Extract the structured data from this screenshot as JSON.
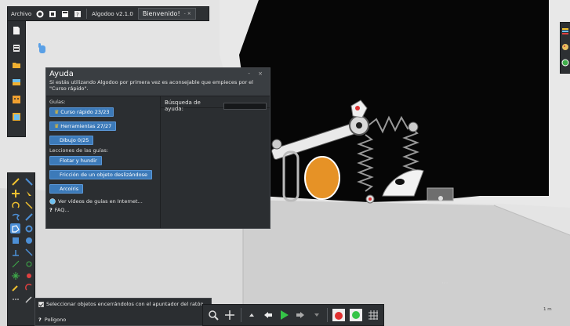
{
  "menubar": {
    "archivo_label": "Archivo",
    "app_version": "Algodoo v2.1.0",
    "tab_label": "Bienvenido!",
    "tab_controls": "- ×"
  },
  "help": {
    "title": "Ayuda",
    "window_controls": "- ×",
    "intro": "Si estás utilizando Algodoo por primera vez es aconsejable que empieces por el \"Curso rápido\".",
    "guides_label": "Guías:",
    "guides": [
      {
        "label": "Curso rápido",
        "progress": "23/23",
        "trophy": true
      },
      {
        "label": "Herramientas",
        "progress": "27/27",
        "trophy": true
      },
      {
        "label": "Dibujo",
        "progress": "0/25",
        "trophy": false
      }
    ],
    "lessons_label": "Lecciones de las guías:",
    "lessons": [
      "Flotar y hundir",
      "Fricción de un objeto deslizándose",
      "Arcoíris"
    ],
    "video_link": "Ver vídeos de guías en Internet...",
    "faq_link": "FAQ...",
    "search_label": "Búsqueda de ayuda:",
    "search_value": ""
  },
  "status": {
    "checkbox_label": "Seleccionar objetos encerrándolos con el apuntador del ratón",
    "checkbox_checked": true,
    "current_tool": "Polígono"
  },
  "scale_label": "1 m",
  "colors": {
    "panel_bg": "#2b2e31",
    "button_blue": "#3c7ab9",
    "scene_black": "#050505",
    "ball_orange": "#e69226",
    "play_green": "#35c447"
  },
  "icons": {
    "menubar": [
      "gear-icon",
      "new-scene-icon",
      "save-icon",
      "help-icon"
    ],
    "left_top": [
      "new-file-icon",
      "clipboard-icon",
      "open-folder-icon",
      "cards-icon",
      "face-icon",
      "notes-icon"
    ],
    "left_bottom": [
      "sketch-tool-icon",
      "pencil-icon",
      "move-tool-icon",
      "drag-tool-icon",
      "rotate-tool-icon",
      "scale-tool-icon",
      "rope-tool-icon",
      "knife-tool-icon",
      "polygon-tool-icon",
      "gear-tool-icon",
      "box-tool-icon",
      "circle-tool-icon",
      "plane-tool-icon",
      "spring-tool-icon",
      "hinge-tool-icon",
      "axle-tool-icon",
      "fixate-tool-icon",
      "tracer-tool-icon",
      "thruster-tool-icon",
      "laser-tool-icon",
      "chain-tool-icon",
      "brush-tool-icon"
    ],
    "controls": [
      "zoom-icon",
      "pan-icon",
      "grid-up-icon",
      "undo-icon",
      "play-icon",
      "redo-icon",
      "grid-down-icon",
      "ball-icon",
      "gear-sim-icon",
      "grid-icon"
    ],
    "right_bar": [
      "stack-icon",
      "palette-icon",
      "world-icon"
    ]
  }
}
